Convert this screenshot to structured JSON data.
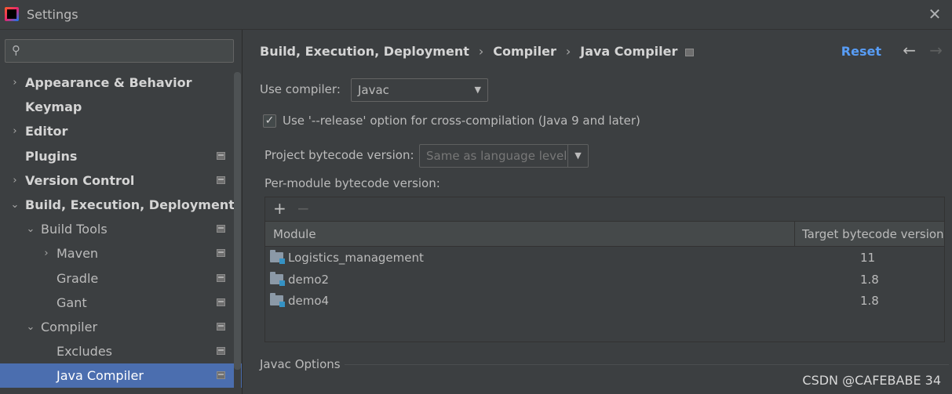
{
  "window": {
    "title": "Settings",
    "close_icon": "close-icon"
  },
  "sidebar": {
    "search_placeholder": "",
    "items": [
      {
        "label": "Appearance & Behavior",
        "level": 0,
        "chevron": "›",
        "bold": true,
        "proj": false
      },
      {
        "label": "Keymap",
        "level": 0,
        "chevron": "",
        "bold": true,
        "proj": false
      },
      {
        "label": "Editor",
        "level": 0,
        "chevron": "›",
        "bold": true,
        "proj": false
      },
      {
        "label": "Plugins",
        "level": 0,
        "chevron": "",
        "bold": true,
        "proj": true
      },
      {
        "label": "Version Control",
        "level": 0,
        "chevron": "›",
        "bold": true,
        "proj": true
      },
      {
        "label": "Build, Execution, Deployment",
        "level": 0,
        "chevron": "⌄",
        "bold": true,
        "proj": false
      },
      {
        "label": "Build Tools",
        "level": 1,
        "chevron": "⌄",
        "bold": false,
        "proj": true
      },
      {
        "label": "Maven",
        "level": 2,
        "chevron": "›",
        "bold": false,
        "proj": true
      },
      {
        "label": "Gradle",
        "level": 2,
        "chevron": "",
        "bold": false,
        "proj": true
      },
      {
        "label": "Gant",
        "level": 2,
        "chevron": "",
        "bold": false,
        "proj": true
      },
      {
        "label": "Compiler",
        "level": 1,
        "chevron": "⌄",
        "bold": false,
        "proj": true
      },
      {
        "label": "Excludes",
        "level": 2,
        "chevron": "",
        "bold": false,
        "proj": true
      },
      {
        "label": "Java Compiler",
        "level": 2,
        "chevron": "",
        "bold": false,
        "proj": true,
        "selected": true
      }
    ]
  },
  "header": {
    "crumbs": [
      "Build, Execution, Deployment",
      "Compiler",
      "Java Compiler"
    ],
    "separator": "›",
    "reset_label": "Reset",
    "back_icon": "←",
    "forward_icon": "→"
  },
  "form": {
    "use_compiler_label": "Use compiler:",
    "use_compiler_value": "Javac",
    "release_option_label": "Use '--release' option for cross-compilation (Java 9 and later)",
    "release_option_checked": true,
    "project_bytecode_label": "Project bytecode version:",
    "project_bytecode_value": "Same as language level",
    "per_module_label": "Per-module bytecode version:"
  },
  "table": {
    "add_icon": "+",
    "remove_icon": "−",
    "columns": [
      "Module",
      "Target bytecode version"
    ],
    "rows": [
      {
        "module": "Logistics_management",
        "version": "11"
      },
      {
        "module": "demo2",
        "version": "1.8"
      },
      {
        "module": "demo4",
        "version": "1.8"
      }
    ]
  },
  "javac_options": {
    "section_title": "Javac Options"
  },
  "watermark": "CSDN @CAFEBABE 34",
  "colors": {
    "accent": "#589df6",
    "selection": "#4b6eaf",
    "background": "#3c3f41"
  }
}
